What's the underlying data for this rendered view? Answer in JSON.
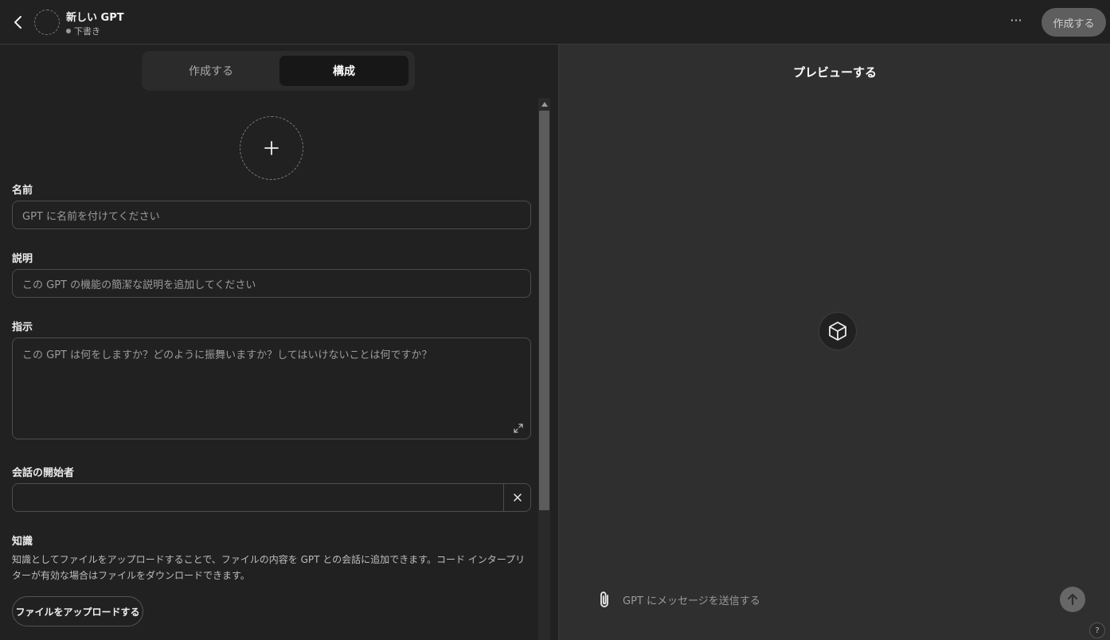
{
  "header": {
    "title": "新しい GPT",
    "status": "下書き",
    "more_label": "···",
    "create_label": "作成する"
  },
  "tabs": [
    {
      "label": "作成する",
      "active": false
    },
    {
      "label": "構成",
      "active": true
    }
  ],
  "form": {
    "name": {
      "label": "名前",
      "placeholder": "GPT に名前を付けてください"
    },
    "description": {
      "label": "説明",
      "placeholder": "この GPT の機能の簡潔な説明を追加してください"
    },
    "instructions": {
      "label": "指示",
      "placeholder": "この GPT は何をしますか？どのように振舞いますか？してはいけないことは何ですか？"
    },
    "starters": {
      "label": "会話の開始者",
      "value": ""
    },
    "knowledge": {
      "label": "知識",
      "description": "知識としてファイルをアップロードすることで、ファイルの内容を GPT との会話に追加できます。コード インタープリターが有効な場合はファイルをダウンロードできます。",
      "upload_label": "ファイルをアップロードする"
    }
  },
  "preview": {
    "title": "プレビューする",
    "message_placeholder": "GPT にメッセージを送信する",
    "help_label": "?"
  },
  "icons": {
    "back": "chevron-left-icon",
    "add": "plus-icon",
    "gpt": "cube-icon",
    "attach": "paperclip-icon",
    "send": "arrow-up-icon",
    "clear": "close-icon",
    "resize": "expand-icon"
  }
}
